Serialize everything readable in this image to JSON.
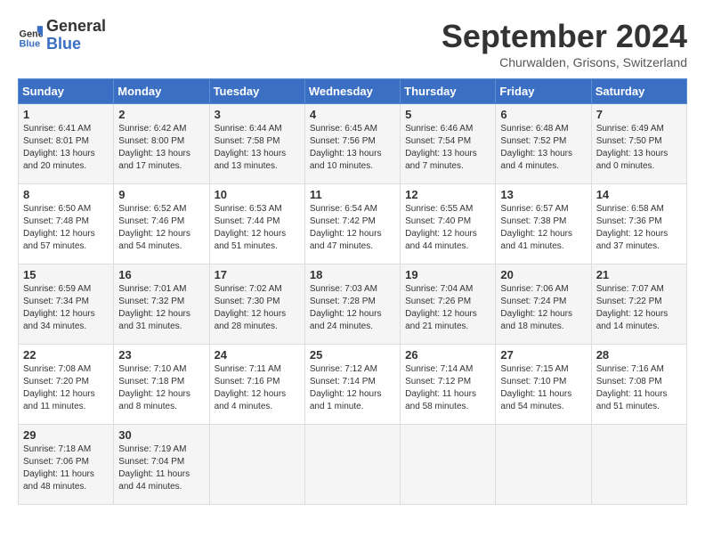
{
  "header": {
    "logo_line1": "General",
    "logo_line2": "Blue",
    "month_title": "September 2024",
    "location": "Churwalden, Grisons, Switzerland"
  },
  "days_of_week": [
    "Sunday",
    "Monday",
    "Tuesday",
    "Wednesday",
    "Thursday",
    "Friday",
    "Saturday"
  ],
  "weeks": [
    [
      {
        "day": "1",
        "info": "Sunrise: 6:41 AM\nSunset: 8:01 PM\nDaylight: 13 hours and 20 minutes."
      },
      {
        "day": "2",
        "info": "Sunrise: 6:42 AM\nSunset: 8:00 PM\nDaylight: 13 hours and 17 minutes."
      },
      {
        "day": "3",
        "info": "Sunrise: 6:44 AM\nSunset: 7:58 PM\nDaylight: 13 hours and 13 minutes."
      },
      {
        "day": "4",
        "info": "Sunrise: 6:45 AM\nSunset: 7:56 PM\nDaylight: 13 hours and 10 minutes."
      },
      {
        "day": "5",
        "info": "Sunrise: 6:46 AM\nSunset: 7:54 PM\nDaylight: 13 hours and 7 minutes."
      },
      {
        "day": "6",
        "info": "Sunrise: 6:48 AM\nSunset: 7:52 PM\nDaylight: 13 hours and 4 minutes."
      },
      {
        "day": "7",
        "info": "Sunrise: 6:49 AM\nSunset: 7:50 PM\nDaylight: 13 hours and 0 minutes."
      }
    ],
    [
      {
        "day": "8",
        "info": "Sunrise: 6:50 AM\nSunset: 7:48 PM\nDaylight: 12 hours and 57 minutes."
      },
      {
        "day": "9",
        "info": "Sunrise: 6:52 AM\nSunset: 7:46 PM\nDaylight: 12 hours and 54 minutes."
      },
      {
        "day": "10",
        "info": "Sunrise: 6:53 AM\nSunset: 7:44 PM\nDaylight: 12 hours and 51 minutes."
      },
      {
        "day": "11",
        "info": "Sunrise: 6:54 AM\nSunset: 7:42 PM\nDaylight: 12 hours and 47 minutes."
      },
      {
        "day": "12",
        "info": "Sunrise: 6:55 AM\nSunset: 7:40 PM\nDaylight: 12 hours and 44 minutes."
      },
      {
        "day": "13",
        "info": "Sunrise: 6:57 AM\nSunset: 7:38 PM\nDaylight: 12 hours and 41 minutes."
      },
      {
        "day": "14",
        "info": "Sunrise: 6:58 AM\nSunset: 7:36 PM\nDaylight: 12 hours and 37 minutes."
      }
    ],
    [
      {
        "day": "15",
        "info": "Sunrise: 6:59 AM\nSunset: 7:34 PM\nDaylight: 12 hours and 34 minutes."
      },
      {
        "day": "16",
        "info": "Sunrise: 7:01 AM\nSunset: 7:32 PM\nDaylight: 12 hours and 31 minutes."
      },
      {
        "day": "17",
        "info": "Sunrise: 7:02 AM\nSunset: 7:30 PM\nDaylight: 12 hours and 28 minutes."
      },
      {
        "day": "18",
        "info": "Sunrise: 7:03 AM\nSunset: 7:28 PM\nDaylight: 12 hours and 24 minutes."
      },
      {
        "day": "19",
        "info": "Sunrise: 7:04 AM\nSunset: 7:26 PM\nDaylight: 12 hours and 21 minutes."
      },
      {
        "day": "20",
        "info": "Sunrise: 7:06 AM\nSunset: 7:24 PM\nDaylight: 12 hours and 18 minutes."
      },
      {
        "day": "21",
        "info": "Sunrise: 7:07 AM\nSunset: 7:22 PM\nDaylight: 12 hours and 14 minutes."
      }
    ],
    [
      {
        "day": "22",
        "info": "Sunrise: 7:08 AM\nSunset: 7:20 PM\nDaylight: 12 hours and 11 minutes."
      },
      {
        "day": "23",
        "info": "Sunrise: 7:10 AM\nSunset: 7:18 PM\nDaylight: 12 hours and 8 minutes."
      },
      {
        "day": "24",
        "info": "Sunrise: 7:11 AM\nSunset: 7:16 PM\nDaylight: 12 hours and 4 minutes."
      },
      {
        "day": "25",
        "info": "Sunrise: 7:12 AM\nSunset: 7:14 PM\nDaylight: 12 hours and 1 minute."
      },
      {
        "day": "26",
        "info": "Sunrise: 7:14 AM\nSunset: 7:12 PM\nDaylight: 11 hours and 58 minutes."
      },
      {
        "day": "27",
        "info": "Sunrise: 7:15 AM\nSunset: 7:10 PM\nDaylight: 11 hours and 54 minutes."
      },
      {
        "day": "28",
        "info": "Sunrise: 7:16 AM\nSunset: 7:08 PM\nDaylight: 11 hours and 51 minutes."
      }
    ],
    [
      {
        "day": "29",
        "info": "Sunrise: 7:18 AM\nSunset: 7:06 PM\nDaylight: 11 hours and 48 minutes."
      },
      {
        "day": "30",
        "info": "Sunrise: 7:19 AM\nSunset: 7:04 PM\nDaylight: 11 hours and 44 minutes."
      },
      {
        "day": "",
        "info": ""
      },
      {
        "day": "",
        "info": ""
      },
      {
        "day": "",
        "info": ""
      },
      {
        "day": "",
        "info": ""
      },
      {
        "day": "",
        "info": ""
      }
    ]
  ]
}
